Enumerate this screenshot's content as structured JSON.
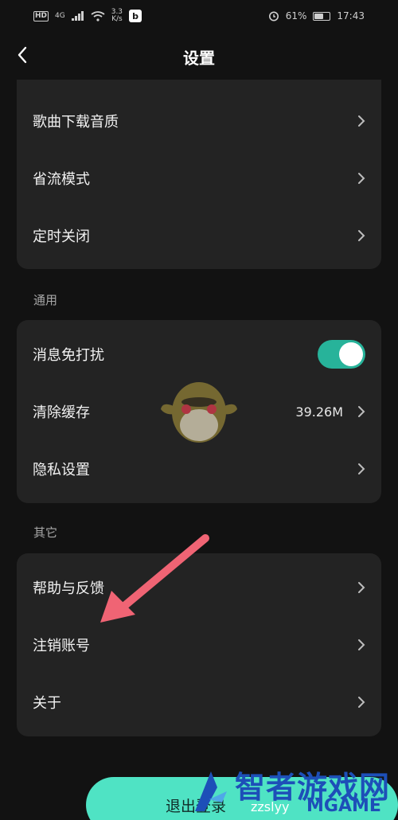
{
  "status_bar": {
    "network_badge": "HD",
    "network_type": "4G",
    "speed_value": "3.3",
    "speed_unit": "K/s",
    "app_badge": "b",
    "battery_percent": "61%",
    "battery_level": 0.61,
    "time": "17:43"
  },
  "nav": {
    "title": "设置",
    "back_icon": "chevron-left-icon"
  },
  "sections": {
    "playback": {
      "items": [
        {
          "label": "歌曲下载音质"
        },
        {
          "label": "省流模式"
        },
        {
          "label": "定时关闭"
        }
      ]
    },
    "general": {
      "title": "通用",
      "items": [
        {
          "label": "消息免打扰",
          "toggle_on": true
        },
        {
          "label": "清除缓存",
          "value": "39.26M"
        },
        {
          "label": "隐私设置"
        }
      ]
    },
    "other": {
      "title": "其它",
      "items": [
        {
          "label": "帮助与反馈"
        },
        {
          "label": "注销账号"
        },
        {
          "label": "关于"
        }
      ]
    }
  },
  "logout_button": {
    "label": "退出登录"
  },
  "watermark": {
    "title": "智者游戏网",
    "domain": "zzslyy",
    "brand": "MGAME"
  },
  "colors": {
    "background": "#121212",
    "card": "#232323",
    "toggle_on": "#27b39a",
    "logout_button": "#4fe3c4",
    "annotation_arrow": "#f06474",
    "watermark": "#1d4fb8"
  }
}
